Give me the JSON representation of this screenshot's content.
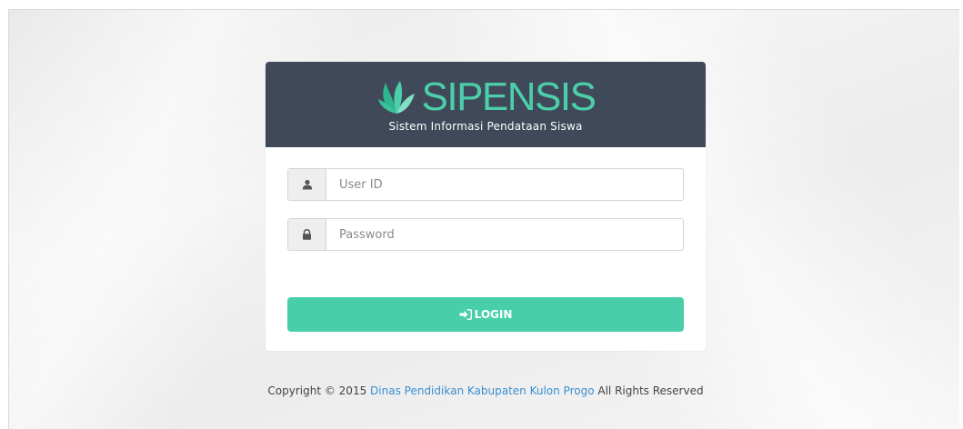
{
  "app": {
    "title": "SIPENSIS",
    "tagline": "Sistem Informasi Pendataan Siswa",
    "logo_icon": "leaf-logo-icon",
    "brand_color": "#4ccfa8",
    "header_color": "#3f4959"
  },
  "form": {
    "userid": {
      "icon": "user-icon",
      "placeholder": "User ID",
      "value": ""
    },
    "password": {
      "icon": "lock-icon",
      "placeholder": "Password",
      "value": ""
    },
    "login": {
      "icon": "sign-in-icon",
      "label": "LOGIN",
      "color": "#48cfa9"
    }
  },
  "footer": {
    "prefix": "Copyright © 2015",
    "link_text": "Dinas Pendidikan Kabupaten Kulon Progo",
    "suffix": "All Rights Reserved",
    "link_color": "#3a8fd0"
  }
}
